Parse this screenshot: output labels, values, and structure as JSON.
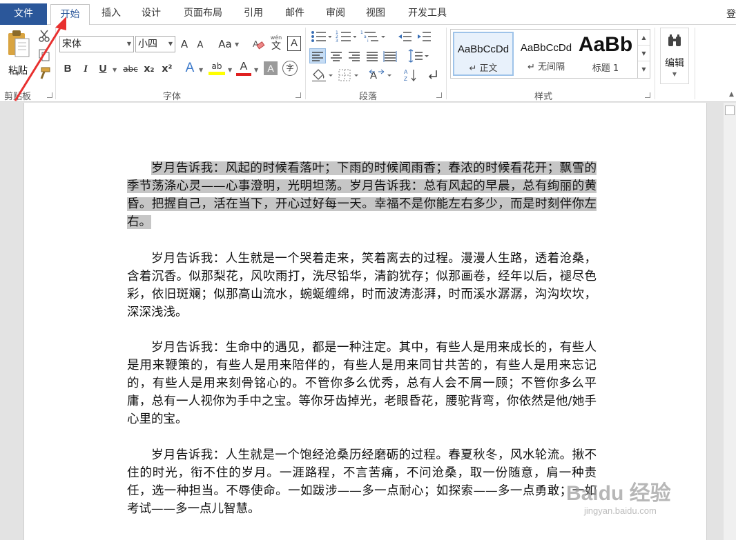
{
  "tabs": {
    "file": "文件",
    "items": [
      "开始",
      "插入",
      "设计",
      "页面布局",
      "引用",
      "邮件",
      "审阅",
      "视图",
      "开发工具"
    ],
    "login": "登"
  },
  "clipboard": {
    "paste": "粘贴",
    "label": "剪贴板"
  },
  "font": {
    "name": "宋体",
    "size": "小四",
    "grow": "A",
    "shrink": "A",
    "change_case": "Aa",
    "phonetic": "文",
    "phonetic_top": "wén",
    "border_char": "A",
    "bold": "B",
    "italic": "I",
    "underline": "U",
    "strike": "abc",
    "sub": "x₂",
    "sup": "x²",
    "effects": "A",
    "highlight": "ab",
    "color": "A",
    "shade": "A",
    "enclose": "字",
    "label": "字体"
  },
  "paragraph": {
    "label": "段落"
  },
  "styles": {
    "label": "样式",
    "tiles": [
      {
        "sample": "AaBbCcDd",
        "name": "↵ 正文"
      },
      {
        "sample": "AaBbCcDd",
        "name": "↵ 无间隔"
      },
      {
        "sample": "AaBb",
        "name": "标题 1"
      }
    ]
  },
  "editing": {
    "label": "编辑"
  },
  "document": {
    "paragraphs": [
      "岁月告诉我：风起的时候看落叶；下雨的时候闻雨香；春浓的时候看花开；飘雪的季节荡涤心灵——心事澄明，光明坦荡。岁月告诉我：总有风起的早晨，总有绚丽的黄昏。把握自己，活在当下，开心过好每一天。幸福不是你能左右多少，而是时刻伴你左右。",
      "岁月告诉我：人生就是一个哭着走来，笑着离去的过程。漫漫人生路，透着沧桑，含着沉香。似那梨花，风吹雨打，洗尽铅华，清韵犹存；似那画卷，经年以后，褪尽色彩，依旧斑斓；似那高山流水，蜿蜒缠绵，时而波涛澎湃，时而溪水潺潺，沟沟坎坎，深深浅浅。",
      "岁月告诉我：生命中的遇见，都是一种注定。其中，有些人是用来成长的，有些人是用来鞭策的，有些人是用来陪伴的，有些人是用来同甘共苦的，有些人是用来忘记的，有些人是用来刻骨铭心的。不管你多么优秀，总有人会不屑一顾；不管你多么平庸，总有一人视你为手中之宝。等你牙齿掉光，老眼昏花，腰驼背弯，你依然是他/她手心里的宝。",
      "岁月告诉我：人生就是一个饱经沧桑历经磨砺的过程。春夏秋冬，风水轮流。揪不住的时光，衔不住的岁月。一涯路程，不言苦痛，不问沧桑，取一份随意，肩一种责任，选一种担当。不辱使命。一如跋涉——多一点耐心；如探索——多一点勇敢；一如考试——多一点儿智慧。"
    ]
  },
  "watermark": {
    "brand": "Baidu 经验",
    "url": "jingyan.baidu.com"
  },
  "colors": {
    "file_tab": "#2b579a",
    "selection": "#c6c6c6",
    "arrow": "#e8302f"
  }
}
